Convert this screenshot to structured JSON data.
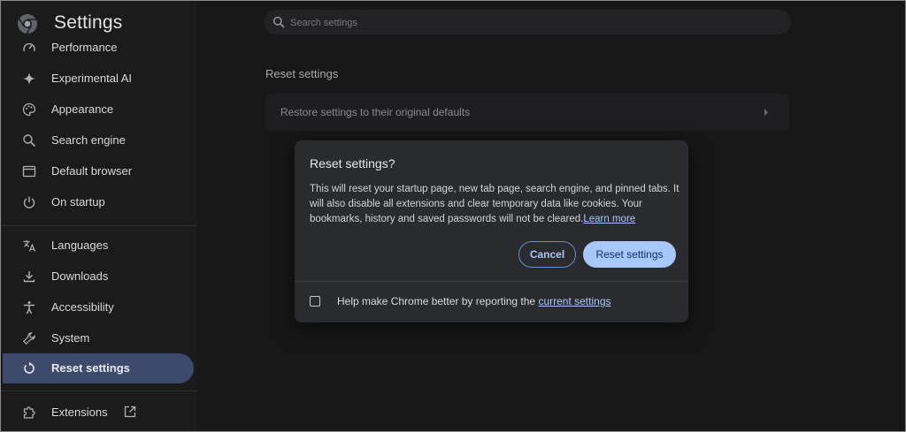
{
  "app": {
    "title": "Settings"
  },
  "search": {
    "placeholder": "Search settings"
  },
  "sidebar": {
    "items": [
      {
        "label": "Performance",
        "icon": "performance-icon"
      },
      {
        "label": "Experimental AI",
        "icon": "sparkle-icon"
      },
      {
        "label": "Appearance",
        "icon": "palette-icon"
      },
      {
        "label": "Search engine",
        "icon": "search-icon"
      },
      {
        "label": "Default browser",
        "icon": "browser-window-icon"
      },
      {
        "label": "On startup",
        "icon": "power-icon"
      },
      {
        "label": "Languages",
        "icon": "translate-icon"
      },
      {
        "label": "Downloads",
        "icon": "download-icon"
      },
      {
        "label": "Accessibility",
        "icon": "accessibility-icon"
      },
      {
        "label": "System",
        "icon": "wrench-icon"
      },
      {
        "label": "Reset settings",
        "icon": "reset-icon",
        "active": true
      },
      {
        "label": "Extensions",
        "icon": "puzzle-icon"
      }
    ]
  },
  "main": {
    "section_title": "Reset settings",
    "card_row_label": "Restore settings to their original defaults"
  },
  "dialog": {
    "title": "Reset settings?",
    "body": "This will reset your startup page, new tab page, search engine, and pinned tabs. It will also disable all extensions and clear temporary data like cookies. Your bookmarks, history and saved passwords will not be cleared.",
    "learn_more": "Learn more",
    "cancel_label": "Cancel",
    "reset_label": "Reset settings",
    "checkbox_label": "Help make Chrome better by reporting the ",
    "checkbox_link": "current settings",
    "checkbox_checked": false
  },
  "colors": {
    "accent": "#a8c7fa",
    "active_nav": "#3d4a6b",
    "dialog_bg": "#2a2b2e"
  }
}
